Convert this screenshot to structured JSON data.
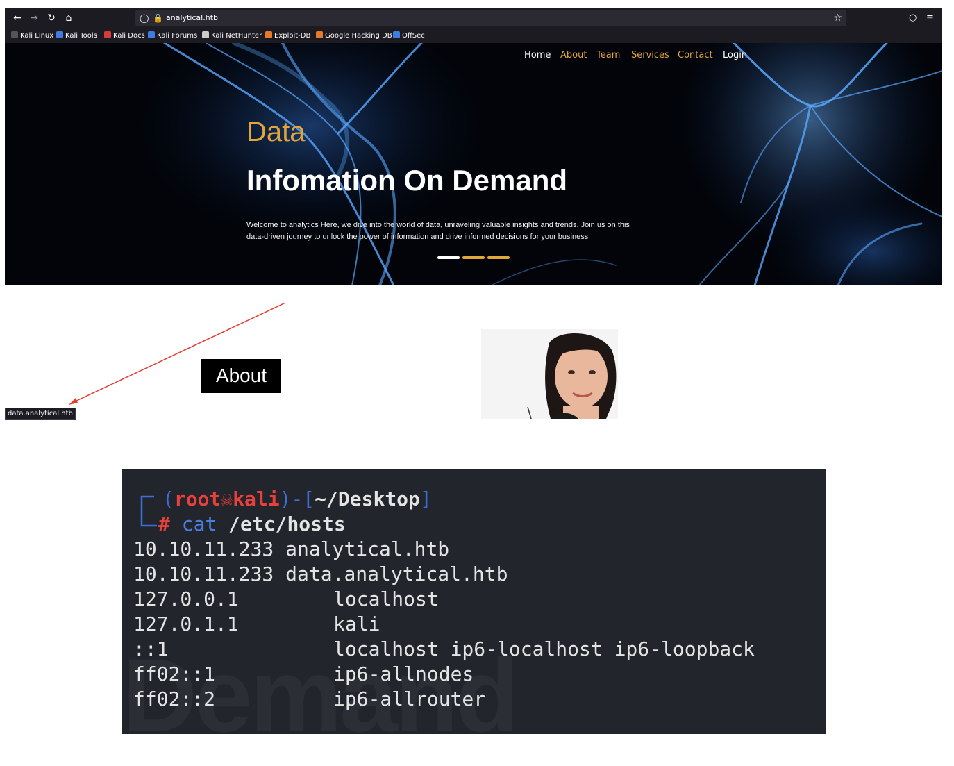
{
  "browser": {
    "url": "analytical.htb",
    "bookmarks": [
      {
        "label": "Kali Linux",
        "color": "#555555"
      },
      {
        "label": "Kali Tools",
        "color": "#3f7be0"
      },
      {
        "label": "Kali Docs",
        "color": "#d93a3a"
      },
      {
        "label": "Kali Forums",
        "color": "#3f7be0"
      },
      {
        "label": "Kali NetHunter",
        "color": "#cccccc"
      },
      {
        "label": "Exploit-DB",
        "color": "#e8792c"
      },
      {
        "label": "Google Hacking DB",
        "color": "#e8792c"
      },
      {
        "label": "OffSec",
        "color": "#3f7be0"
      }
    ]
  },
  "site": {
    "nav": [
      {
        "label": "Home",
        "color": "#ffffff"
      },
      {
        "label": "About",
        "color": "#e3a63a"
      },
      {
        "label": "Team",
        "color": "#e3a63a"
      },
      {
        "label": "Services",
        "color": "#e3a63a"
      },
      {
        "label": "Contact",
        "color": "#e3a63a"
      },
      {
        "label": "Login",
        "color": "#ffffff"
      }
    ],
    "hero_kicker": "Data",
    "hero_title": "Infomation On Demand",
    "hero_text": "Welcome to analytics Here, we dive into the world of data, unraveling valuable insights and trends. Join us on this data-driven journey to unlock the power of information and drive informed decisions for your business",
    "about_heading": "About",
    "accent_color": "#e3a63a"
  },
  "status_tooltip": "data.analytical.htb",
  "terminal": {
    "prompt_user": "root",
    "prompt_host": "kali",
    "prompt_dir": "~/Desktop",
    "command": "cat",
    "argument": "/etc/hosts",
    "hosts": [
      {
        "ip": "10.10.11.233",
        "name": "analytical.htb"
      },
      {
        "ip": "10.10.11.233",
        "name": "data.analytical.htb"
      },
      {
        "ip": "127.0.0.1",
        "name": "localhost"
      },
      {
        "ip": "127.0.1.1",
        "name": "kali"
      },
      {
        "ip": "::1",
        "name": "localhost ip6-localhost ip6-loopback"
      },
      {
        "ip": "ff02::1",
        "name": "ip6-allnodes"
      },
      {
        "ip": "ff02::2",
        "name": "ip6-allrouter"
      }
    ],
    "watermark": "Demand"
  }
}
